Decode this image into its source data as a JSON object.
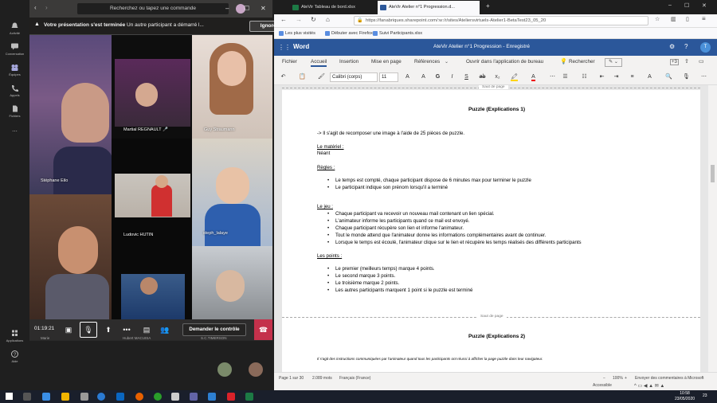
{
  "teams": {
    "search_placeholder": "Recherchez ou tapez une commande",
    "rail": [
      {
        "label": "Activité"
      },
      {
        "label": "Conversation"
      },
      {
        "label": "Équipes"
      },
      {
        "label": "Appels"
      },
      {
        "label": "Fichiers"
      },
      {
        "label": "..."
      },
      {
        "label": "Applications"
      },
      {
        "label": "Aide"
      }
    ],
    "banner_title": "Votre présentation s'est terminée",
    "banner_message": "Un autre participant a démarré l...",
    "banner_button": "Ignorer",
    "participants": [
      {
        "name": "Stéphane Eilo"
      },
      {
        "name": "Martial REGNAULT"
      },
      {
        "name": "Guy Straumann"
      },
      {
        "name": "Ludovic HUTIN"
      },
      {
        "name": "steph_lalaye"
      },
      {
        "name": "Marie"
      },
      {
        "name": "Hubert MACUISA"
      },
      {
        "name": "S.C.TIMERSON"
      }
    ],
    "timer": "01:19:21",
    "request_control": "Demander le contrôle"
  },
  "browser": {
    "tabs": [
      {
        "label": "AteVir Tableau de bord.xlsx"
      },
      {
        "label": "AteVir Atelier n°1 Progression.d..."
      }
    ],
    "url": "https://fanabriques.sharepoint.com/:w:/r/sites/Ateliersvirtuels-Atelier1-BetaTest23_05_20",
    "bookmarks": [
      "Les plus visités",
      "Débuter avec Firefox",
      "Suivi Participants.xlsx"
    ]
  },
  "word": {
    "app_name": "Word",
    "doc_title": "AteVir Atelier n°1 Progression  -  Enregistré",
    "user_initial": "T",
    "ribbon_tabs": [
      "Fichier",
      "Accueil",
      "Insertion",
      "Mise en page",
      "Références",
      "Ouvrir dans l'application de bureau",
      "Rechercher"
    ],
    "font_name": "Calibri (corps)",
    "font_size": "11",
    "page_break_label": "Saut de page",
    "content": {
      "heading": "Puzzle (Explications 1)",
      "intro": "-> Il s'agit de recomposer une image à l'aide de 25 pièces de puzzle.",
      "materiel_label": "Le matériel :",
      "materiel_value": "Néant",
      "regles_label": "Règles :",
      "regles": [
        "Le temps est compté, chaque participant dispose de 6 minutes max pour terminer le puzzle",
        "Le participant indique son prénom lorsqu'il a terminé"
      ],
      "jeu_label": "Le jeu :",
      "jeu": [
        "Chaque participant va recevoir un nouveau mail contenant un lien spécial.",
        "L'animateur informe les participants quand ce mail est envoyé.",
        "Chaque participant récupère son lien et informe l'animateur.",
        "Tout le monde attend que l'animateur donne les informations complémentaires avant de continuer.",
        "Lorsque le temps est écoulé, l'animateur clique sur le lien et récupère les temps réalisés des différents participants"
      ],
      "points_label": "Les points :",
      "points": [
        "Le premier (meilleurs temps) marque 4 points.",
        "Le second marque 3 points.",
        "Le troisième marque 2 points.",
        "Les autres participants marquent 1 point si le puzzle est terminé"
      ],
      "heading2": "Puzzle (Explications 2)",
      "intro2": "Il s'agit des instructions communiquées par l'animateur quand tous les participants ont réussi à afficher la page puzzle dans leur navigateur."
    },
    "status": {
      "page": "Page 1 sur 30",
      "words": "2.089 mots",
      "language": "Français (France)",
      "zoom": "100%",
      "feedback": "Envoyer des commentaires à Microsoft",
      "accessibility": "Accessible"
    }
  },
  "taskbar": {
    "time": "10:58",
    "date": "23/05/2020",
    "notif_count": "23"
  }
}
